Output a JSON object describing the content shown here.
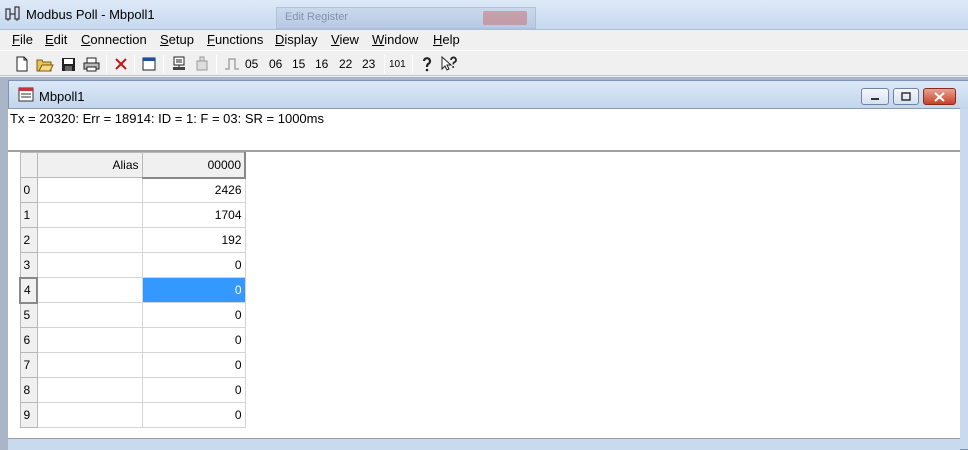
{
  "window": {
    "title": "Modbus Poll - Mbpoll1",
    "ghost_title": "Edit Register"
  },
  "menu": [
    "File",
    "Edit",
    "Connection",
    "Setup",
    "Functions",
    "Display",
    "View",
    "Window",
    "Help"
  ],
  "toolbar": {
    "func_codes": [
      "05",
      "06",
      "15",
      "16",
      "22",
      "23"
    ],
    "num_label": "101",
    "icons": [
      "new-icon",
      "open-icon",
      "save-icon",
      "print-icon",
      "delete-icon",
      "window-icon",
      "connect-icon",
      "disconnect-icon",
      "pulse-icon",
      "help-icon",
      "context-help-icon"
    ]
  },
  "child": {
    "title": "Mbpoll1",
    "status": "Tx = 20320: Err = 18914: ID = 1: F = 03: SR = 1000ms"
  },
  "grid": {
    "columns": [
      "Alias",
      "00000"
    ],
    "rows": [
      {
        "index": "0",
        "alias": "",
        "value": "2426"
      },
      {
        "index": "1",
        "alias": "",
        "value": "1704"
      },
      {
        "index": "2",
        "alias": "",
        "value": "192"
      },
      {
        "index": "3",
        "alias": "",
        "value": "0"
      },
      {
        "index": "4",
        "alias": "",
        "value": "0"
      },
      {
        "index": "5",
        "alias": "",
        "value": "0"
      },
      {
        "index": "6",
        "alias": "",
        "value": "0"
      },
      {
        "index": "7",
        "alias": "",
        "value": "0"
      },
      {
        "index": "8",
        "alias": "",
        "value": "0"
      },
      {
        "index": "9",
        "alias": "",
        "value": "0"
      }
    ],
    "selected_row": 4
  },
  "colors": {
    "selection": "#3399ff",
    "close_button": "#c8402a"
  }
}
